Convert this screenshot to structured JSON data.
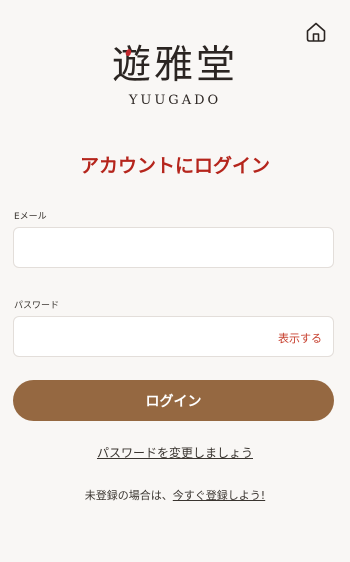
{
  "header": {
    "home_icon": "home-icon"
  },
  "logo": {
    "kanji": "遊雅堂",
    "roman": "YUUGADO"
  },
  "login": {
    "title": "アカウントにログイン",
    "email_label": "Eメール",
    "email_value": "",
    "password_label": "パスワード",
    "password_value": "",
    "show_password": "表示する",
    "submit": "ログイン"
  },
  "links": {
    "change_password": "パスワードを変更しましょう",
    "signup_prefix": "未登録の場合は、",
    "signup_link": "今すぐ登録しよう!"
  },
  "colors": {
    "background": "#f9f7f5",
    "accent_red": "#b5251c",
    "button_brown": "#956841",
    "text": "#3a3530"
  }
}
